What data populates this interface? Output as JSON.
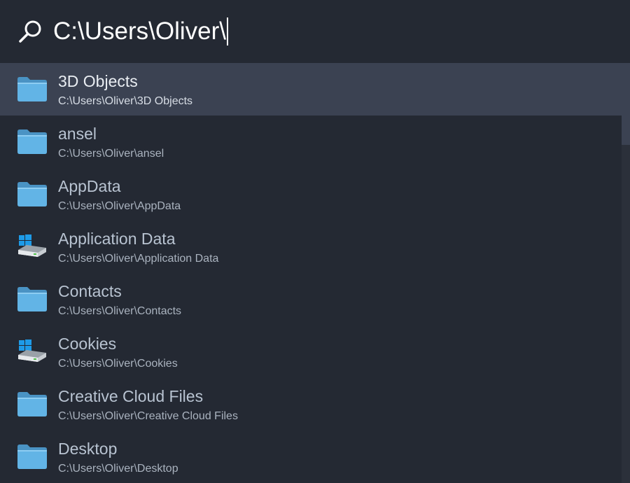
{
  "search": {
    "query": "C:\\Users\\Oliver\\"
  },
  "results": [
    {
      "title": "3D Objects",
      "path": "C:\\Users\\Oliver\\3D Objects",
      "icon": "folder-icon",
      "selected": true
    },
    {
      "title": "ansel",
      "path": "C:\\Users\\Oliver\\ansel",
      "icon": "folder-icon",
      "selected": false
    },
    {
      "title": "AppData",
      "path": "C:\\Users\\Oliver\\AppData",
      "icon": "folder-icon",
      "selected": false
    },
    {
      "title": "Application Data",
      "path": "C:\\Users\\Oliver\\Application Data",
      "icon": "windows-drive-icon",
      "selected": false
    },
    {
      "title": "Contacts",
      "path": "C:\\Users\\Oliver\\Contacts",
      "icon": "folder-icon",
      "selected": false
    },
    {
      "title": "Cookies",
      "path": "C:\\Users\\Oliver\\Cookies",
      "icon": "windows-drive-icon",
      "selected": false
    },
    {
      "title": "Creative Cloud Files",
      "path": "C:\\Users\\Oliver\\Creative Cloud Files",
      "icon": "folder-icon",
      "selected": false
    },
    {
      "title": "Desktop",
      "path": "C:\\Users\\Oliver\\Desktop",
      "icon": "folder-icon",
      "selected": false
    }
  ],
  "colors": {
    "background": "#242933",
    "selected": "#3b4252",
    "folder": "#5aa9dc",
    "windows_logo": "#1e9be8"
  }
}
